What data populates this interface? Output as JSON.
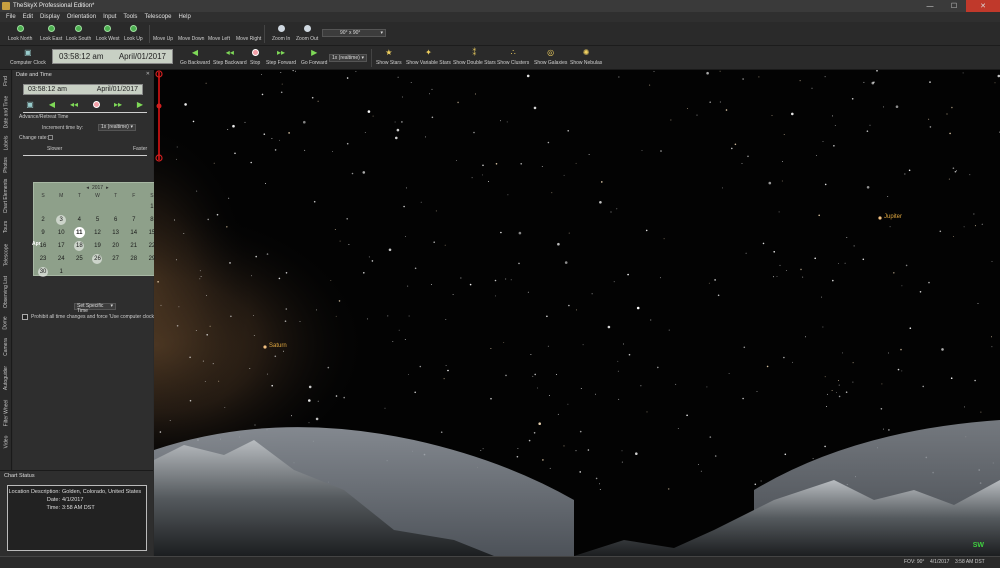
{
  "window": {
    "title": "TheSkyX Professional Edition*",
    "buttons": [
      "—",
      "☐",
      "✕"
    ]
  },
  "menu": [
    "File",
    "Edit",
    "Display",
    "Orientation",
    "Input",
    "Tools",
    "Telescope",
    "Help"
  ],
  "toolbar1": [
    {
      "label": "Look North",
      "icon": "look-north-icon"
    },
    {
      "label": "Look East",
      "icon": "look-east-icon"
    },
    {
      "label": "Look South",
      "icon": "look-south-icon"
    },
    {
      "label": "Look West",
      "icon": "look-west-icon"
    },
    {
      "label": "Look Up",
      "icon": "look-up-icon"
    },
    {
      "label": "Move Up",
      "icon": "arrow-up-icon"
    },
    {
      "label": "Move Down",
      "icon": "arrow-down-icon"
    },
    {
      "label": "Move Left",
      "icon": "arrow-left-icon"
    },
    {
      "label": "Move Right",
      "icon": "arrow-right-icon"
    },
    {
      "label": "Zoom In",
      "icon": "zoom-in-icon"
    },
    {
      "label": "Zoom Out",
      "icon": "zoom-out-icon"
    }
  ],
  "fov_select": "90° x 90°",
  "toolbar2": {
    "computer_clock": "Computer Clock",
    "clock_time": "03:58:12 am",
    "clock_date": "April/01/2017",
    "buttons": [
      {
        "label": "Go Backward",
        "icon": "go-backward-icon"
      },
      {
        "label": "Step Backward",
        "icon": "step-backward-icon"
      },
      {
        "label": "Stop",
        "icon": "stop-icon"
      },
      {
        "label": "Step Forward",
        "icon": "step-forward-icon"
      },
      {
        "label": "Go Forward",
        "icon": "go-forward-icon"
      }
    ],
    "rate_select": "1x (realtime)",
    "show_buttons": [
      {
        "label": "Show Stars",
        "icon": "star-icon"
      },
      {
        "label": "Show Variable Stars",
        "icon": "variable-star-icon"
      },
      {
        "label": "Show Double Stars",
        "icon": "double-star-icon"
      },
      {
        "label": "Show Clusters",
        "icon": "cluster-icon"
      },
      {
        "label": "Show Galaxies",
        "icon": "galaxy-icon"
      },
      {
        "label": "Show Nebulas",
        "icon": "nebula-icon"
      }
    ]
  },
  "vtabs": [
    "Find",
    "Date and Time",
    "Labels",
    "Photos",
    "Chart Elements",
    "Tours",
    "Telescope",
    "Observing List",
    "Dome",
    "Camera",
    "Autoguider",
    "Filter Wheel",
    "Video"
  ],
  "panel": {
    "title": "Date and Time",
    "close": "✕",
    "clock_time": "03:58:12 am",
    "clock_date": "April/01/2017",
    "advance_label": "Advance/Retreat Time",
    "increment_label": "Increment time by:",
    "increment_value": "1x (realtime)",
    "change_rate_label": "Change rate:",
    "slower": "Slower",
    "faster": "Faster",
    "set_time_select": "Set Specific Time",
    "prohibit_label": "Prohibit all time changes and force 'Use computer clock'"
  },
  "calendar": {
    "year": "2017",
    "month": "Apr",
    "weekdays": [
      "S",
      "M",
      "T",
      "W",
      "T",
      "F",
      "S"
    ],
    "days": [
      "",
      "",
      "",
      "",
      "",
      "",
      "1",
      "2",
      "3",
      "4",
      "5",
      "6",
      "7",
      "8",
      "9",
      "10",
      "11",
      "12",
      "13",
      "14",
      "15",
      "16",
      "17",
      "18",
      "19",
      "20",
      "21",
      "22",
      "23",
      "24",
      "25",
      "26",
      "27",
      "28",
      "29",
      "30",
      "1",
      "",
      "",
      "",
      "",
      ""
    ],
    "today": "11"
  },
  "chart_status": {
    "title": "Chart Status",
    "rows": [
      {
        "k": "Location Description:",
        "v": "Golden, Colorado, United States"
      },
      {
        "k": "Date:",
        "v": "4/1/2017"
      },
      {
        "k": "Time:",
        "v": "3:58 AM DST"
      }
    ]
  },
  "sky": {
    "planets": [
      {
        "name": "Jupiter"
      },
      {
        "name": "Saturn"
      }
    ],
    "compass": "SW"
  },
  "statusbar": {
    "fov": "FOV: 90°",
    "date": "4/1/2017",
    "time": "3:58 AM DST"
  }
}
